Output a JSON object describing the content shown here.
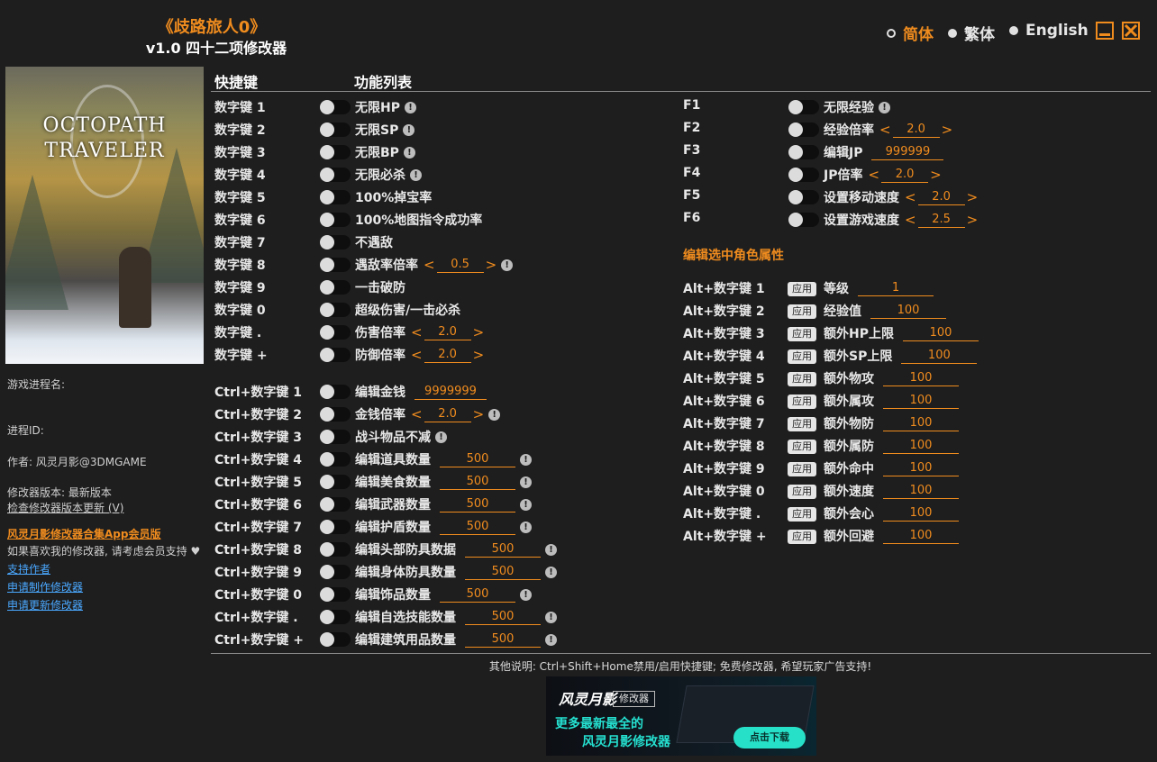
{
  "app": {
    "title": "《歧路旅人0》",
    "subtitle": "v1.0 四十二项修改器"
  },
  "lang": {
    "simplified": "简体",
    "traditional": "繁体",
    "english": "English"
  },
  "cover": {
    "title_line1": "OCTOPATH",
    "title_line2": "TRAVELER"
  },
  "info": {
    "process_name": "游戏进程名:",
    "process_id": "进程ID:",
    "author": "作者: 风灵月影@3DMGAME",
    "version": "修改器版本: 最新版本",
    "check_update": "检查修改器版本更新 (V)",
    "app_promo": "风灵月影修改器合集App会员版",
    "support_msg": "如果喜欢我的修改器, 请考虑会员支持",
    "support_author": "支持作者",
    "request_make": "申请制作修改器",
    "request_update": "申请更新修改器"
  },
  "headers": {
    "hotkey": "快捷键",
    "features": "功能列表"
  },
  "left_rows": [
    {
      "key": "数字键 1",
      "label": "无限HP",
      "warn": true
    },
    {
      "key": "数字键 2",
      "label": "无限SP",
      "warn": true
    },
    {
      "key": "数字键 3",
      "label": "无限BP",
      "warn": true
    },
    {
      "key": "数字键 4",
      "label": "无限必杀",
      "warn": true
    },
    {
      "key": "数字键 5",
      "label": "100%掉宝率"
    },
    {
      "key": "数字键 6",
      "label": "100%地图指令成功率"
    },
    {
      "key": "数字键 7",
      "label": "不遇敌"
    },
    {
      "key": "数字键 8",
      "label": "遇敌率倍率",
      "spin": "0.5",
      "warn": true
    },
    {
      "key": "数字键 9",
      "label": "一击破防"
    },
    {
      "key": "数字键 0",
      "label": "超级伤害/一击必杀"
    },
    {
      "key": "数字键 .",
      "label": "伤害倍率",
      "spin": "2.0"
    },
    {
      "key": "数字键 +",
      "label": "防御倍率",
      "spin": "2.0"
    },
    {
      "key": "Ctrl+数字键 1",
      "label": "编辑金钱",
      "value": "9999999"
    },
    {
      "key": "Ctrl+数字键 2",
      "label": "金钱倍率",
      "spin": "2.0",
      "warn": true
    },
    {
      "key": "Ctrl+数字键 3",
      "label": "战斗物品不减",
      "warn": true
    },
    {
      "key": "Ctrl+数字键 4",
      "label": "编辑道具数量",
      "value": "500",
      "warn": true
    },
    {
      "key": "Ctrl+数字键 5",
      "label": "编辑美食数量",
      "value": "500",
      "warn": true
    },
    {
      "key": "Ctrl+数字键 6",
      "label": "编辑武器数量",
      "value": "500",
      "warn": true
    },
    {
      "key": "Ctrl+数字键 7",
      "label": "编辑护盾数量",
      "value": "500",
      "warn": true
    },
    {
      "key": "Ctrl+数字键 8",
      "label": "编辑头部防具数据",
      "value": "500",
      "warn": true
    },
    {
      "key": "Ctrl+数字键 9",
      "label": "编辑身体防具数量",
      "value": "500",
      "warn": true
    },
    {
      "key": "Ctrl+数字键 0",
      "label": "编辑饰品数量",
      "value": "500",
      "warn": true
    },
    {
      "key": "Ctrl+数字键 .",
      "label": "编辑自选技能数量",
      "value": "500",
      "warn": true
    },
    {
      "key": "Ctrl+数字键 +",
      "label": "编辑建筑用品数量",
      "value": "500",
      "warn": true
    }
  ],
  "right_rows": [
    {
      "key": "F1",
      "label": "无限经验",
      "warn": true
    },
    {
      "key": "F2",
      "label": "经验倍率",
      "spin": "2.0"
    },
    {
      "key": "F3",
      "label": "编辑JP",
      "value": "999999"
    },
    {
      "key": "F4",
      "label": "JP倍率",
      "spin": "2.0"
    },
    {
      "key": "F5",
      "label": "设置移动速度",
      "spin": "2.0"
    },
    {
      "key": "F6",
      "label": "设置游戏速度",
      "spin": "2.5"
    }
  ],
  "section_char": "编辑选中角色属性",
  "apply_label": "应用",
  "char_rows": [
    {
      "key": "Alt+数字键 1",
      "label": "等级",
      "value": "1"
    },
    {
      "key": "Alt+数字键 2",
      "label": "经验值",
      "value": "100"
    },
    {
      "key": "Alt+数字键 3",
      "label": "额外HP上限",
      "value": "100"
    },
    {
      "key": "Alt+数字键 4",
      "label": "额外SP上限",
      "value": "100"
    },
    {
      "key": "Alt+数字键 5",
      "label": "额外物攻",
      "value": "100"
    },
    {
      "key": "Alt+数字键 6",
      "label": "额外属攻",
      "value": "100"
    },
    {
      "key": "Alt+数字键 7",
      "label": "额外物防",
      "value": "100"
    },
    {
      "key": "Alt+数字键 8",
      "label": "额外属防",
      "value": "100"
    },
    {
      "key": "Alt+数字键 9",
      "label": "额外命中",
      "value": "100"
    },
    {
      "key": "Alt+数字键 0",
      "label": "额外速度",
      "value": "100"
    },
    {
      "key": "Alt+数字键 .",
      "label": "额外会心",
      "value": "100"
    },
    {
      "key": "Alt+数字键 +",
      "label": "额外回避",
      "value": "100"
    }
  ],
  "footer": "其他说明: Ctrl+Shift+Home禁用/启用快捷键; 免费修改器, 希望玩家广告支持!",
  "banner": {
    "logo": "风灵月影",
    "tag": "修改器",
    "line1": "更多最新最全的",
    "line2": "风灵月影修改器",
    "download": "点击下载"
  }
}
